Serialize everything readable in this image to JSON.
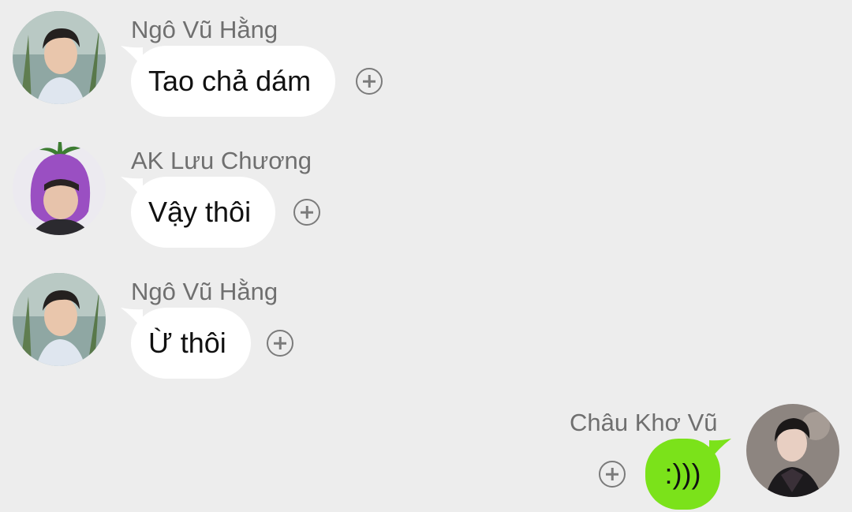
{
  "messages": [
    {
      "sender": "Ngô Vũ Hằng",
      "text": "Tao chả dám",
      "direction": "incoming",
      "avatar": "avatar-ngo-vu-hang"
    },
    {
      "sender": "AK Lưu Chương",
      "text": "Vậy thôi",
      "direction": "incoming",
      "avatar": "avatar-ak-luu-chuong"
    },
    {
      "sender": "Ngô Vũ Hằng",
      "text": "Ừ thôi",
      "direction": "incoming",
      "avatar": "avatar-ngo-vu-hang"
    },
    {
      "sender": "Châu Khơ Vũ",
      "text": ":)))",
      "direction": "outgoing",
      "avatar": "avatar-chau-kho-vu"
    }
  ],
  "icons": {
    "react": "plus-circle-icon"
  },
  "colors": {
    "background": "#ededed",
    "incoming_bubble": "#ffffff",
    "outgoing_bubble": "#7be21a",
    "sender_name": "#6f6f6f"
  }
}
